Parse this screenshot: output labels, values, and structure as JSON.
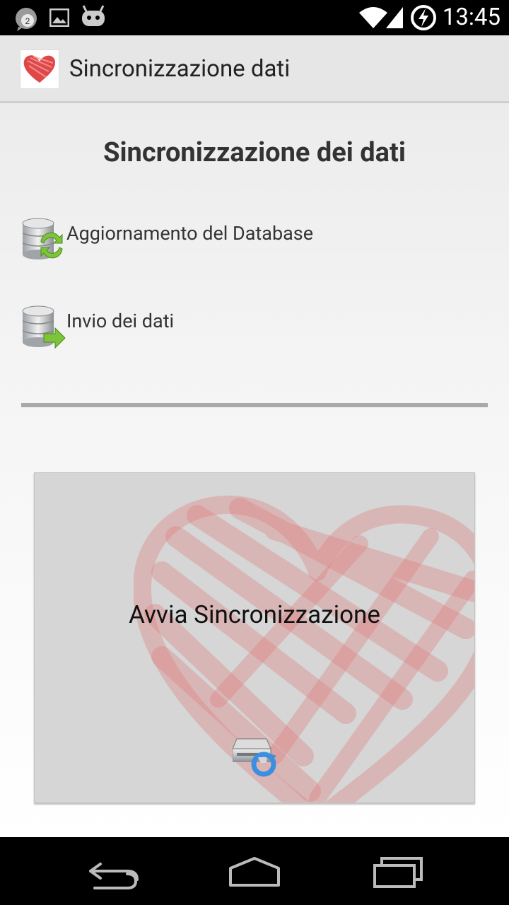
{
  "status_bar": {
    "time": "13:45",
    "notification_count": "2",
    "icons": [
      "chat-notification-icon",
      "image-notification-icon",
      "android-debug-icon",
      "wifi-icon",
      "signal-icon",
      "battery-charging-icon"
    ]
  },
  "action_bar": {
    "title": "Sincronizzazione dati",
    "icon": "heart-app-icon"
  },
  "main": {
    "heading": "Sincronizzazione dei dati",
    "rows": [
      {
        "label": "Aggiornamento del Database",
        "icon": "database-sync-icon"
      },
      {
        "label": "Invio dei dati",
        "icon": "database-send-icon"
      }
    ],
    "sync_button": {
      "label": "Avvia Sincronizzazione",
      "icon": "drive-sync-icon"
    }
  },
  "nav_bar": {
    "buttons": [
      "back-icon",
      "home-icon",
      "recents-icon"
    ]
  },
  "colors": {
    "accent_heart": "#e04848",
    "action_bar_bg": "#e6e6e6",
    "button_bg": "#d6d6d6"
  }
}
